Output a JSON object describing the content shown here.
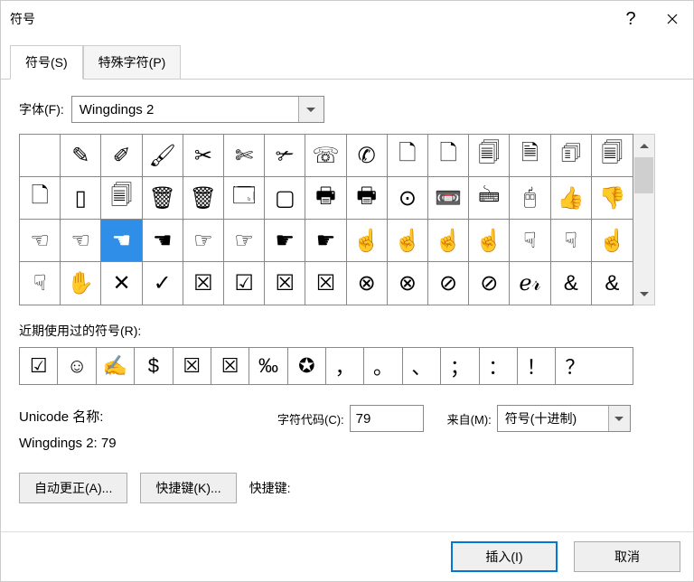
{
  "titlebar": {
    "title": "符号",
    "help": "?"
  },
  "tabs": [
    {
      "label": "符号(S)",
      "active": true
    },
    {
      "label": "特殊字符(P)",
      "active": false
    }
  ],
  "font": {
    "label": "字体(F):",
    "value": "Wingdings 2"
  },
  "grid": {
    "cols": 15,
    "rows": 4,
    "selected_index": 32,
    "cells": [
      "",
      "✎",
      "✐",
      "🖌",
      "✂",
      "✄",
      "✃",
      "☏",
      "✆",
      "🗋",
      "🗋",
      "🗐",
      "🗎",
      "🗊",
      "🗐",
      "🗋",
      "▯",
      "🗐",
      "🗑",
      "🗑",
      "🗔",
      "▢",
      "🖶",
      "🖶",
      "⊙",
      "📼",
      "🖮",
      "🖰",
      "👍",
      "👎",
      "☜",
      "☜",
      "☚",
      "☚",
      "☞",
      "☞",
      "☛",
      "☛",
      "☝",
      "☝",
      "☝",
      "☝",
      "☟",
      "☟",
      "☝",
      "☟",
      "✋",
      "✕",
      "✓",
      "☒",
      "☑",
      "☒",
      "☒",
      "⊗",
      "⊗",
      "⊘",
      "⊘",
      "ℯ𝓇",
      "&",
      "&"
    ]
  },
  "recent": {
    "label": "近期使用过的符号(R):",
    "cells": [
      "☑",
      "☺",
      "✍",
      "$",
      "☒",
      "☒",
      "‰",
      "✪",
      "，",
      "。",
      "、",
      "；",
      "：",
      "！",
      "？",
      ""
    ]
  },
  "info": {
    "unicode_name_label": "Unicode 名称:",
    "unicode_name_value": "Wingdings 2: 79",
    "char_code_label": "字符代码(C):",
    "char_code_value": "79",
    "from_label": "来自(M):",
    "from_value": "符号(十进制)"
  },
  "buttons": {
    "autocorrect": "自动更正(A)...",
    "shortcut_key": "快捷键(K)...",
    "shortcut_label": "快捷键:"
  },
  "footer": {
    "insert": "插入(I)",
    "cancel": "取消"
  }
}
